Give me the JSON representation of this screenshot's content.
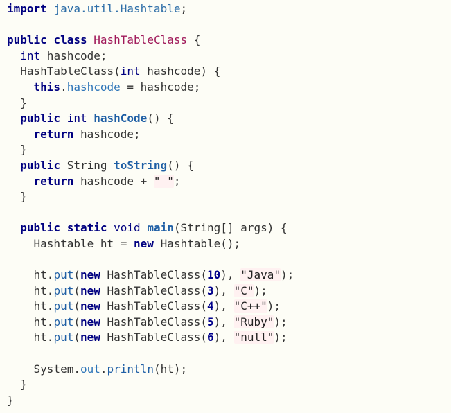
{
  "colors": {
    "background": "#fdfdf6",
    "keyword": "#000080",
    "class_name": "#a0195a",
    "method": "#1f5fa5",
    "package": "#2f6fa8",
    "string_bg": "#fff1f1"
  },
  "lines": [
    [
      {
        "t": "import",
        "c": "kw"
      },
      {
        "t": " "
      },
      {
        "t": "java.util.Hashtable",
        "c": "pkg"
      },
      {
        "t": ";"
      }
    ],
    [],
    [
      {
        "t": "public",
        "c": "kw"
      },
      {
        "t": " "
      },
      {
        "t": "class",
        "c": "kw"
      },
      {
        "t": " "
      },
      {
        "t": "HashTableClass",
        "c": "cls"
      },
      {
        "t": " {"
      }
    ],
    [
      {
        "t": "  "
      },
      {
        "t": "int",
        "c": "type"
      },
      {
        "t": " hashcode;"
      }
    ],
    [
      {
        "t": "  HashTableClass("
      },
      {
        "t": "int",
        "c": "type"
      },
      {
        "t": " hashcode) {"
      }
    ],
    [
      {
        "t": "    "
      },
      {
        "t": "this",
        "c": "kw"
      },
      {
        "t": "."
      },
      {
        "t": "hashcode",
        "c": "fld"
      },
      {
        "t": " = hashcode;"
      }
    ],
    [
      {
        "t": "  }"
      }
    ],
    [
      {
        "t": "  "
      },
      {
        "t": "public",
        "c": "kw"
      },
      {
        "t": " "
      },
      {
        "t": "int",
        "c": "type"
      },
      {
        "t": " "
      },
      {
        "t": "hashCode",
        "c": "fn"
      },
      {
        "t": "() {"
      }
    ],
    [
      {
        "t": "    "
      },
      {
        "t": "return",
        "c": "kw"
      },
      {
        "t": " hashcode;"
      }
    ],
    [
      {
        "t": "  }"
      }
    ],
    [
      {
        "t": "  "
      },
      {
        "t": "public",
        "c": "kw"
      },
      {
        "t": " String "
      },
      {
        "t": "toString",
        "c": "fn"
      },
      {
        "t": "() {"
      }
    ],
    [
      {
        "t": "    "
      },
      {
        "t": "return",
        "c": "kw"
      },
      {
        "t": " hashcode + "
      },
      {
        "t": "\" \"",
        "c": "str"
      },
      {
        "t": ";"
      }
    ],
    [
      {
        "t": "  }"
      }
    ],
    [],
    [
      {
        "t": "  "
      },
      {
        "t": "public",
        "c": "kw"
      },
      {
        "t": " "
      },
      {
        "t": "static",
        "c": "kw"
      },
      {
        "t": " "
      },
      {
        "t": "void",
        "c": "type"
      },
      {
        "t": " "
      },
      {
        "t": "main",
        "c": "fn"
      },
      {
        "t": "(String[] args) {"
      }
    ],
    [
      {
        "t": "    Hashtable ht = "
      },
      {
        "t": "new",
        "c": "kw"
      },
      {
        "t": " Hashtable();"
      }
    ],
    [],
    [
      {
        "t": "    ht."
      },
      {
        "t": "put",
        "c": "mth"
      },
      {
        "t": "("
      },
      {
        "t": "new",
        "c": "kw"
      },
      {
        "t": " HashTableClass("
      },
      {
        "t": "10",
        "c": "num"
      },
      {
        "t": "), "
      },
      {
        "t": "\"Java\"",
        "c": "str"
      },
      {
        "t": ");"
      }
    ],
    [
      {
        "t": "    ht."
      },
      {
        "t": "put",
        "c": "mth"
      },
      {
        "t": "("
      },
      {
        "t": "new",
        "c": "kw"
      },
      {
        "t": " HashTableClass("
      },
      {
        "t": "3",
        "c": "num"
      },
      {
        "t": "), "
      },
      {
        "t": "\"C\"",
        "c": "str"
      },
      {
        "t": ");"
      }
    ],
    [
      {
        "t": "    ht."
      },
      {
        "t": "put",
        "c": "mth"
      },
      {
        "t": "("
      },
      {
        "t": "new",
        "c": "kw"
      },
      {
        "t": " HashTableClass("
      },
      {
        "t": "4",
        "c": "num"
      },
      {
        "t": "), "
      },
      {
        "t": "\"C++\"",
        "c": "str"
      },
      {
        "t": ");"
      }
    ],
    [
      {
        "t": "    ht."
      },
      {
        "t": "put",
        "c": "mth"
      },
      {
        "t": "("
      },
      {
        "t": "new",
        "c": "kw"
      },
      {
        "t": " HashTableClass("
      },
      {
        "t": "5",
        "c": "num"
      },
      {
        "t": "), "
      },
      {
        "t": "\"Ruby\"",
        "c": "str"
      },
      {
        "t": ");"
      }
    ],
    [
      {
        "t": "    ht."
      },
      {
        "t": "put",
        "c": "mth"
      },
      {
        "t": "("
      },
      {
        "t": "new",
        "c": "kw"
      },
      {
        "t": " HashTableClass("
      },
      {
        "t": "6",
        "c": "num"
      },
      {
        "t": "), "
      },
      {
        "t": "\"null\"",
        "c": "str"
      },
      {
        "t": ");"
      }
    ],
    [],
    [
      {
        "t": "    System."
      },
      {
        "t": "out",
        "c": "fld"
      },
      {
        "t": "."
      },
      {
        "t": "println",
        "c": "mth"
      },
      {
        "t": "(ht);"
      }
    ],
    [
      {
        "t": "  }"
      }
    ],
    [
      {
        "t": "}"
      }
    ]
  ]
}
